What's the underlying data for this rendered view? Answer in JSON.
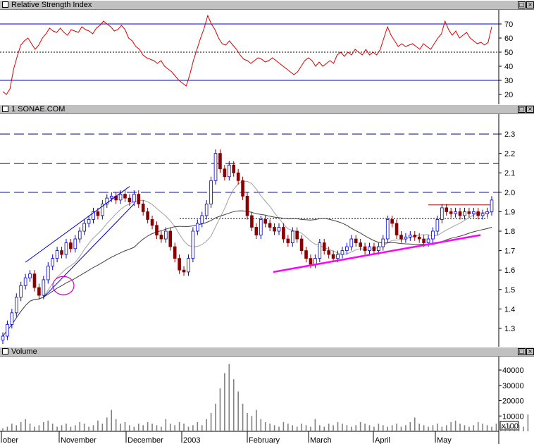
{
  "window": {
    "rsi_title": "Relative Strength Index",
    "price_title": "1 SONAE.COM",
    "volume_title": "Volume",
    "maximize_glyph": "□",
    "close_glyph": "×"
  },
  "chart_data": [
    {
      "type": "line",
      "name": "rsi",
      "yticks": [
        20,
        30,
        40,
        50,
        60,
        70
      ],
      "ylim": [
        15,
        79
      ],
      "reference_lines": [
        {
          "value": 70,
          "style": "solid",
          "color": "#0000c0"
        },
        {
          "value": 50,
          "style": "dotted",
          "color": "#000000"
        },
        {
          "value": 30,
          "style": "solid",
          "color": "#0000c0"
        }
      ],
      "series_color": "#dd0000",
      "values": [
        22,
        20,
        24,
        38,
        47,
        55,
        58,
        60,
        56,
        52,
        55,
        60,
        63,
        67,
        65,
        64,
        67,
        64,
        62,
        66,
        65,
        64,
        68,
        66,
        65,
        63,
        67,
        69,
        72,
        70,
        68,
        65,
        66,
        69,
        66,
        60,
        58,
        54,
        52,
        48,
        46,
        45,
        44,
        42,
        44,
        40,
        38,
        36,
        33,
        30,
        28,
        26,
        34,
        44,
        52,
        60,
        67,
        76,
        70,
        66,
        60,
        56,
        55,
        58,
        55,
        52,
        48,
        45,
        44,
        42,
        44,
        46,
        45,
        43,
        44,
        46,
        44,
        42,
        40,
        38,
        36,
        34,
        36,
        40,
        44,
        46,
        44,
        40,
        43,
        40,
        42,
        44,
        42,
        48,
        50,
        47,
        50,
        48,
        52,
        50,
        48,
        52,
        48,
        50,
        48,
        52,
        60,
        68,
        62,
        58,
        54,
        56,
        54,
        55,
        56,
        54,
        52,
        56,
        54,
        52,
        56,
        60,
        63,
        72,
        66,
        62,
        65,
        60,
        62,
        64,
        60,
        58,
        56,
        57,
        55,
        57,
        68
      ]
    },
    {
      "type": "candlestick",
      "name": "price",
      "yticks": [
        1.3,
        1.4,
        1.5,
        1.6,
        1.7,
        1.8,
        1.9,
        2.0,
        2.1,
        2.2,
        2.3
      ],
      "ylim": [
        1.22,
        2.38
      ],
      "up_color": "#0000cc",
      "down_color": "#880000",
      "ma_short_color": "#a0a0a0",
      "ma_long_color": "#404040",
      "support_line_color": "#ff00ff",
      "resistance_levels_dashed": [
        2.3,
        2.15,
        2.0
      ],
      "dotted_level": 1.865,
      "breakout_marker_level": 1.935,
      "close": [
        1.26,
        1.32,
        1.38,
        1.46,
        1.52,
        1.56,
        1.58,
        1.51,
        1.47,
        1.55,
        1.62,
        1.66,
        1.7,
        1.68,
        1.74,
        1.71,
        1.76,
        1.8,
        1.84,
        1.86,
        1.9,
        1.88,
        1.94,
        1.97,
        1.98,
        1.96,
        1.99,
        1.97,
        1.95,
        1.99,
        1.94,
        1.9,
        1.86,
        1.83,
        1.78,
        1.76,
        1.8,
        1.72,
        1.66,
        1.6,
        1.59,
        1.66,
        1.8,
        1.84,
        1.88,
        1.94,
        2.06,
        2.2,
        2.12,
        2.08,
        2.14,
        2.1,
        2.06,
        1.98,
        1.88,
        1.82,
        1.78,
        1.86,
        1.84,
        1.82,
        1.8,
        1.82,
        1.76,
        1.74,
        1.8,
        1.76,
        1.7,
        1.66,
        1.63,
        1.66,
        1.74,
        1.7,
        1.68,
        1.66,
        1.68,
        1.7,
        1.72,
        1.76,
        1.74,
        1.72,
        1.7,
        1.72,
        1.7,
        1.72,
        1.76,
        1.86,
        1.84,
        1.78,
        1.76,
        1.77,
        1.78,
        1.77,
        1.76,
        1.74,
        1.76,
        1.8,
        1.86,
        1.92,
        1.9,
        1.89,
        1.9,
        1.88,
        1.9,
        1.89,
        1.9,
        1.88,
        1.89,
        1.9,
        1.96
      ]
    },
    {
      "type": "bar",
      "name": "volume",
      "yticks": [
        10000,
        20000,
        30000,
        40000
      ],
      "ylim": [
        0,
        46000
      ],
      "unit_box": "x100",
      "bar_color": "#808080",
      "values": [
        2000,
        3000,
        5000,
        4000,
        6000,
        8000,
        5000,
        3000,
        4000,
        6000,
        7000,
        5000,
        3000,
        4000,
        5000,
        3000,
        4000,
        6000,
        5000,
        3000,
        4000,
        7000,
        5000,
        9000,
        14000,
        8000,
        5000,
        6000,
        4000,
        3000,
        5000,
        4000,
        6000,
        5000,
        4000,
        3000,
        8000,
        5000,
        4000,
        6000,
        5000,
        3000,
        4000,
        6000,
        4000,
        8000,
        12000,
        18000,
        28000,
        38000,
        44000,
        34000,
        26000,
        18000,
        12000,
        10000,
        14000,
        8000,
        6000,
        5000,
        4000,
        3000,
        6000,
        5000,
        4000,
        3000,
        5000,
        4000,
        3000,
        8000,
        4000,
        3000,
        5000,
        4000,
        6000,
        5000,
        4000,
        3000,
        4000,
        6000,
        5000,
        4000,
        3000,
        5000,
        4000,
        3000,
        4000,
        5000,
        3000,
        4000,
        6000,
        9000,
        5000,
        4000,
        3000,
        4000,
        5000,
        3000,
        4000,
        6000,
        7000,
        5000,
        4000,
        3000,
        4000,
        6000,
        5000,
        4000,
        3000,
        5000,
        4000,
        3000,
        4000,
        3000,
        4000,
        3000,
        11000
      ],
      "month_labels": [
        "ober",
        "November",
        "December",
        "2003",
        "February",
        "March",
        "April",
        "May"
      ]
    }
  ]
}
